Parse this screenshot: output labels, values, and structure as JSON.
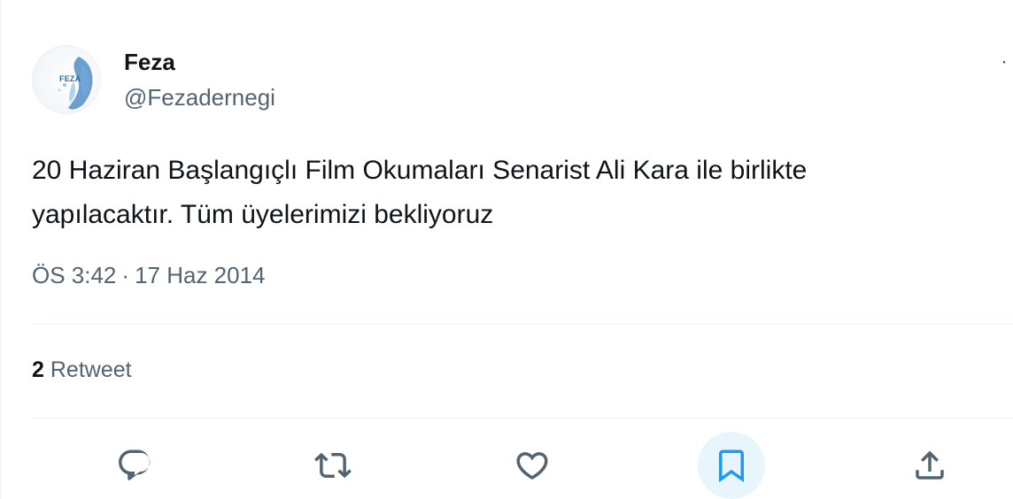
{
  "author": {
    "name": "Feza",
    "handle": "@Fezadernegi",
    "avatar_text": "FEZA"
  },
  "tweet": {
    "text": "20 Haziran Başlangıçlı Film Okumaları Senarist Ali Kara ile birlikte\nyapılacaktır. Tüm üyelerimizi bekliyoruz",
    "time": "ÖS 3:42",
    "separator": "·",
    "date": "17 Haz 2014"
  },
  "stats": {
    "retweet_count": "2",
    "retweet_label": "Retweet"
  },
  "more_icon": "·",
  "actions": [
    {
      "name": "reply",
      "icon": "reply-icon"
    },
    {
      "name": "retweet",
      "icon": "retweet-icon"
    },
    {
      "name": "like",
      "icon": "heart-icon"
    },
    {
      "name": "bookmark",
      "icon": "bookmark-icon",
      "active": true
    },
    {
      "name": "share",
      "icon": "share-icon"
    }
  ],
  "colors": {
    "text": "#0f1419",
    "secondary": "#536471",
    "accent": "#1d9bf0",
    "bookmark_bg": "#e8f5fd"
  }
}
